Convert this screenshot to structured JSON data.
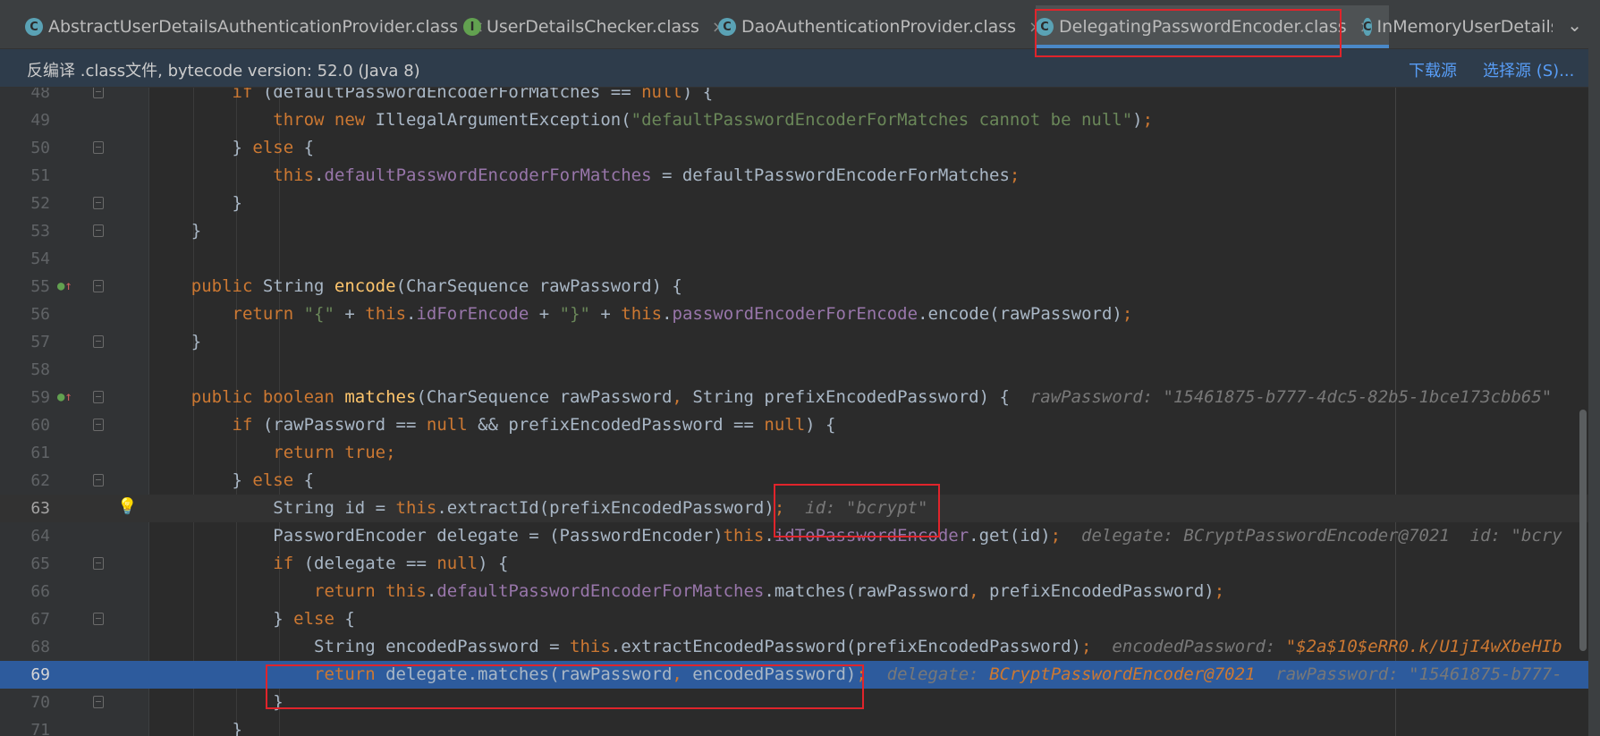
{
  "tabs": [
    {
      "icon": "C",
      "label": "AbstractUserDetailsAuthenticationProvider.class",
      "closable": true
    },
    {
      "icon": "I",
      "label": "UserDetailsChecker.class",
      "closable": true
    },
    {
      "icon": "C",
      "label": "DaoAuthenticationProvider.class",
      "closable": true
    },
    {
      "icon": "C",
      "label": "DelegatingPasswordEncoder.class",
      "closable": true,
      "active": true
    },
    {
      "icon": "C",
      "label": "InMemoryUserDetails",
      "closable": false
    }
  ],
  "tab_close_glyph": "×",
  "tab_overflow_glyph": "⌄",
  "infobar": {
    "message": "反编译 .class文件, bytecode version: 52.0 (Java 8)",
    "download_link": "下载源",
    "choose_source_link": "选择源 (S)..."
  },
  "code_lines": [
    {
      "num": "48",
      "code": "        if (defaultPasswordEncoderForMatches == null) {"
    },
    {
      "num": "49",
      "code": "            throw new IllegalArgumentException(\"defaultPasswordEncoderForMatches cannot be null\");"
    },
    {
      "num": "50",
      "code": "        } else {"
    },
    {
      "num": "51",
      "code": "            this.defaultPasswordEncoderForMatches = defaultPasswordEncoderForMatches;"
    },
    {
      "num": "52",
      "code": "        }"
    },
    {
      "num": "53",
      "code": "    }"
    },
    {
      "num": "54",
      "code": ""
    },
    {
      "num": "55",
      "code": "    public String encode(CharSequence rawPassword) {"
    },
    {
      "num": "56",
      "code": "        return \"{\" + this.idForEncode + \"}\" + this.passwordEncoderForEncode.encode(rawPassword);"
    },
    {
      "num": "57",
      "code": "    }"
    },
    {
      "num": "58",
      "code": ""
    },
    {
      "num": "59",
      "code": "    public boolean matches(CharSequence rawPassword, String prefixEncodedPassword) {",
      "hint": "rawPassword: \"15461875-b777-4dc5-82b5-1bce173cbb65\""
    },
    {
      "num": "60",
      "code": "        if (rawPassword == null && prefixEncodedPassword == null) {"
    },
    {
      "num": "61",
      "code": "            return true;"
    },
    {
      "num": "62",
      "code": "        } else {"
    },
    {
      "num": "63",
      "code": "            String id = this.extractId(prefixEncodedPassword);",
      "hint": "id: \"bcrypt\""
    },
    {
      "num": "64",
      "code": "            PasswordEncoder delegate = (PasswordEncoder)this.idToPasswordEncoder.get(id);",
      "hint": "delegate: BCryptPasswordEncoder@7021  id: \"bcry"
    },
    {
      "num": "65",
      "code": "            if (delegate == null) {"
    },
    {
      "num": "66",
      "code": "                return this.defaultPasswordEncoderForMatches.matches(rawPassword, prefixEncodedPassword);"
    },
    {
      "num": "67",
      "code": "            } else {"
    },
    {
      "num": "68",
      "code": "                String encodedPassword = this.extractEncodedPassword(prefixEncodedPassword);",
      "hint_label": "encodedPassword: ",
      "hint_value": "\"$2a$10$eRR0.k/U1jI4wXbeHIb"
    },
    {
      "num": "69",
      "code": "                return delegate.matches(rawPassword, encodedPassword);",
      "hint_label": "delegate: ",
      "hint_value": "BCryptPasswordEncoder@7021",
      "hint_tail": "  rawPassword: \"15461875-b777-"
    },
    {
      "num": "70",
      "code": "            }"
    },
    {
      "num": "71",
      "code": "        }"
    }
  ],
  "colors": {
    "keyword": "#cc7832",
    "string": "#6a8759",
    "field": "#9876aa",
    "method": "#ffc66d",
    "execution_line": "#2d5b9d",
    "annotation_box": "#e0242b"
  }
}
